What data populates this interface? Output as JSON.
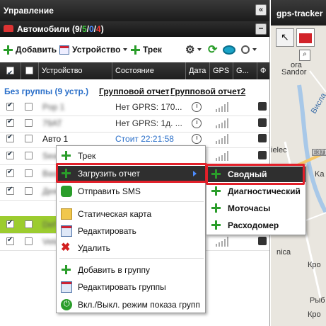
{
  "panel": {
    "title": "Управление",
    "collapse": "«"
  },
  "subpanel": {
    "title_prefix": "Автомобили (9/",
    "count_green": "5",
    "sep1": "/",
    "count_blue": "0",
    "sep2": "/",
    "count_red": "4",
    "close": ")",
    "minimize": "−"
  },
  "toolbar": {
    "add": "Добавить",
    "device": "Устройство",
    "track": "Трек"
  },
  "table": {
    "headers": [
      "Устройство",
      "Состояние",
      "Дата",
      "GPS",
      "G...",
      "Ф"
    ],
    "group": {
      "label": "Без группы (9 устр.)",
      "report1": "Групповой отчет",
      "report2": "Групповой отчет2"
    },
    "rows": [
      {
        "device": "Pop 1",
        "status": "Нет GPRS: 170...",
        "blur": true
      },
      {
        "device": "79AT",
        "status": "Нет GPRS: 1д. ...",
        "blur": true
      },
      {
        "device": "Авто 1",
        "status": "Стоит 22:21:58",
        "blur": false
      },
      {
        "device": "Sea",
        "status": "",
        "blur": true
      },
      {
        "device": "Bas",
        "status": "",
        "blur": true
      },
      {
        "device": "Дея",
        "status": "",
        "blur": true
      },
      {
        "device": "Def",
        "status": "",
        "blur": true
      },
      {
        "device": "Velo",
        "status": "",
        "blur": true
      }
    ]
  },
  "context_menu": {
    "items": [
      "Трек",
      "Загрузить отчет",
      "Отправить SMS",
      "Статическая карта",
      "Редактировать",
      "Удалить",
      "Добавить в группу",
      "Редактировать группы",
      "Вкл./Выкл. режим показа групп"
    ]
  },
  "submenu": {
    "items": [
      "Сводный",
      "Диагностический",
      "Моточасы",
      "Расходомер"
    ]
  },
  "map": {
    "title": "gps-tracker",
    "labels": [
      "ora",
      "Sandor",
      "ielec",
      "Висла",
      "E371",
      "Ka",
      "nica",
      "Кро",
      "Рыб",
      "Кро"
    ]
  },
  "colors": {
    "accent": "#e2202a",
    "green": "#2a9d2a",
    "header": "#1e1e1e",
    "highlight": "#9ccc2f"
  }
}
